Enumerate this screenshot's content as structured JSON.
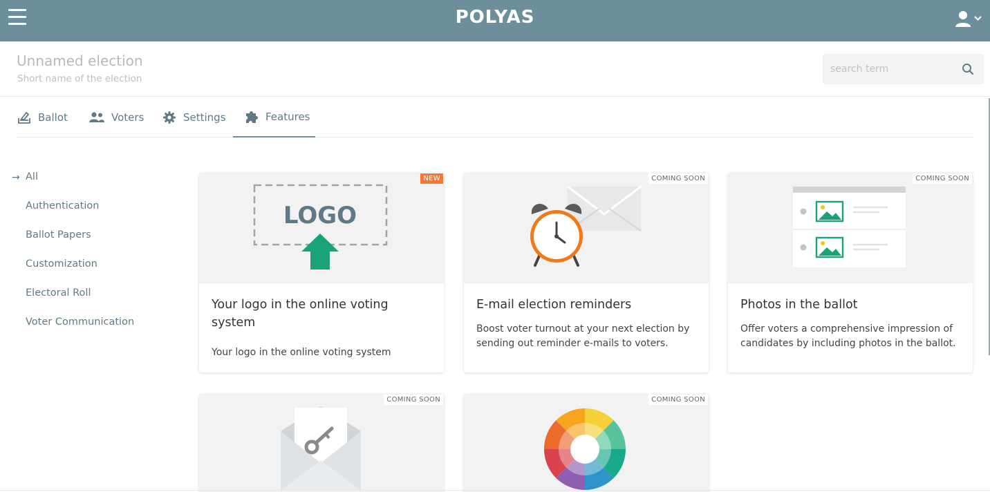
{
  "app": {
    "brand": "POLYAS"
  },
  "election": {
    "title": "Unnamed election",
    "subtitle": "Short name of the election"
  },
  "search": {
    "placeholder": "search term"
  },
  "tabs": [
    {
      "label": "Ballot",
      "icon": "ballot-box-icon",
      "active": false
    },
    {
      "label": "Voters",
      "icon": "people-icon",
      "active": false
    },
    {
      "label": "Settings",
      "icon": "gear-icon",
      "active": false
    },
    {
      "label": "Features",
      "icon": "puzzle-icon",
      "active": true
    }
  ],
  "sidebar": {
    "items": [
      {
        "label": "All",
        "active": true
      },
      {
        "label": "Authentication"
      },
      {
        "label": "Ballot Papers"
      },
      {
        "label": "Customization"
      },
      {
        "label": "Electoral Roll"
      },
      {
        "label": "Voter Communication"
      }
    ]
  },
  "cards": [
    {
      "badge": "NEW",
      "title": "Your logo in the online voting system",
      "description": "Your logo in the online voting system",
      "illustration_text": "LOGO"
    },
    {
      "badge": "COMING SOON",
      "title": "E-mail election reminders",
      "description": "Boost voter turnout at your next election by sending out reminder e-mails to voters."
    },
    {
      "badge": "COMING SOON",
      "title": "Photos in the ballot",
      "description": "Offer voters a comprehensive impression of candidates by including photos in the ballot."
    },
    {
      "badge": "COMING SOON"
    },
    {
      "badge": "COMING SOON"
    }
  ],
  "colors": {
    "header_bg": "#6d8f9b",
    "accent_text": "#5f7a86",
    "new_badge": "#f07a33",
    "upload_arrow": "#1aa37a"
  }
}
